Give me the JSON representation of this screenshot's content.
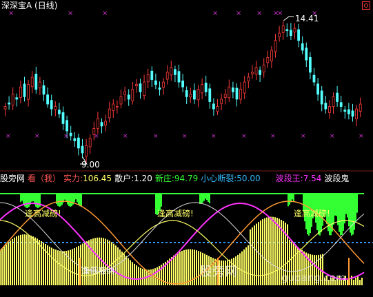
{
  "title": "深深宝A (日线)",
  "price_labels": {
    "high": "14.41",
    "low": "9.00"
  },
  "indicator": {
    "name": "股旁网",
    "mode": "看（我）",
    "shili_label": "实力:",
    "shili_value": "106.45",
    "sanhu_label": "散户:",
    "sanhu_value": "1.20",
    "xinzhuang_label": "新庄:",
    "xinzhuang_value": "94.79",
    "xiaoxin_label": "小心断裂:",
    "xiaoxin_value": "50.00",
    "boduanwang_label": "波段王:",
    "boduanwang_value": "7.54",
    "boduangui_label": "波段鬼"
  },
  "annotations": {
    "feng_gao_1": "逢高减磅!",
    "feng_gao_2": "逢高减磅!",
    "feng_gao_3": "逢高减磅!",
    "feng_di": "逢低吸纳!",
    "watermark": "股旁网",
    "watermark_url": "gupang.com"
  },
  "colors": {
    "background": "#000000",
    "up_candle": "#ff3b3b",
    "down_candle": "#54ffff",
    "marker": "#cc33cc",
    "green": "#33ff33",
    "yellow": "#ffff66",
    "orange": "#ff9933",
    "magenta": "#ff33ff",
    "blue_dotted": "#3399ff"
  },
  "chart_data": {
    "type": "candlestick",
    "title": "深深宝A (日线)",
    "close_series_approx": [
      10.9,
      11.0,
      11.4,
      11.2,
      11.7,
      11.3,
      11.8,
      12.1,
      11.6,
      11.9,
      11.4,
      11.0,
      10.8,
      10.9,
      10.6,
      10.2,
      9.9,
      9.7,
      9.5,
      9.2,
      9.0,
      9.3,
      9.6,
      10.0,
      10.4,
      10.1,
      10.3,
      10.8,
      11.0,
      10.9,
      11.3,
      11.5,
      11.2,
      11.6,
      11.8,
      11.5,
      11.9,
      12.2,
      12.0,
      11.8,
      11.6,
      11.9,
      12.3,
      12.5,
      12.2,
      11.9,
      11.7,
      11.3,
      11.4,
      11.2,
      11.6,
      11.8,
      11.5,
      11.1,
      10.8,
      10.9,
      11.2,
      11.4,
      11.7,
      11.5,
      11.2,
      11.6,
      11.9,
      12.1,
      12.3,
      12.5,
      12.2,
      12.6,
      12.9,
      13.2,
      13.6,
      13.9,
      14.2,
      14.0,
      13.8,
      14.1,
      13.6,
      13.2,
      12.8,
      12.3,
      11.9,
      11.4,
      11.0,
      10.8,
      10.9,
      11.3,
      11.1,
      10.9,
      10.7,
      10.6,
      10.5,
      10.8,
      11.0
    ],
    "price_high_label": 14.41,
    "price_low_label": 9.0
  }
}
